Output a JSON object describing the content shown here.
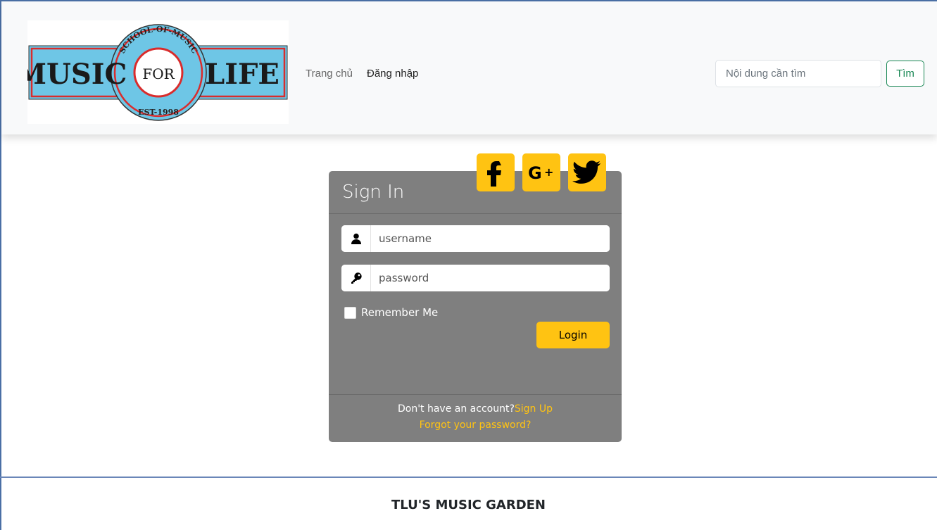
{
  "header": {
    "logo": {
      "top_text": "SCHOOL-OF-MUSIC",
      "left_word": "MUSIC",
      "center_word": "FOR",
      "right_word": "LIFE",
      "bottom_text": "EST-1998"
    },
    "nav": [
      {
        "label": "Trang chủ"
      },
      {
        "label": "Đăng nhập"
      }
    ],
    "search": {
      "placeholder": "Nội dung cần tìm",
      "button_label": "Tìm"
    }
  },
  "signin": {
    "title": "Sign In",
    "social_icons": [
      "facebook-icon",
      "google-plus-icon",
      "twitter-icon"
    ],
    "username_placeholder": "username",
    "password_placeholder": "password",
    "remember_label": "Remember Me",
    "login_label": "Login",
    "no_account_text": "Don't have an account?",
    "signup_link": "Sign Up",
    "forgot_link": "Forgot your password?"
  },
  "footer": {
    "title": "TLU'S MUSIC GARDEN"
  },
  "colors": {
    "accent": "#FFC312",
    "search_button": "#198754",
    "logo_blue": "#6ec6e6",
    "logo_red": "#d92c2c"
  }
}
